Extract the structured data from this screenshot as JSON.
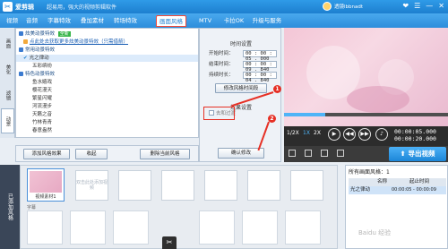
{
  "app": {
    "name": "爱剪辑",
    "slogan": "超易用，强大的视频剪辑软件",
    "account": "透镜lbbnadt",
    "window_buttons": [
      "❤",
      "☰",
      "—",
      "✕"
    ]
  },
  "tabs": [
    {
      "label": "视频"
    },
    {
      "label": "音频"
    },
    {
      "label": "字幕特效"
    },
    {
      "label": "叠加素材"
    },
    {
      "label": "转场特效"
    },
    {
      "label": "画面风格"
    },
    {
      "label": "MTV"
    },
    {
      "label": "卡拉OK"
    },
    {
      "label": "升级与服务"
    }
  ],
  "active_tab": "画面风格",
  "side_nav": [
    {
      "label": "画面"
    },
    {
      "label": "美化"
    },
    {
      "label": "滤镜"
    },
    {
      "label": "动景"
    }
  ],
  "effect_list": [
    {
      "label": "炫美动景特效",
      "type": "category",
      "tag": "全新"
    },
    {
      "label": "点此处去获取更多炫美动景特效（只需借箭）",
      "type": "link"
    },
    {
      "label": "常用动景特效",
      "type": "category"
    },
    {
      "label": "光之律动",
      "type": "item",
      "selected": true
    },
    {
      "label": "五彩缤纷",
      "type": "item"
    },
    {
      "label": "特色动景特效",
      "type": "category"
    },
    {
      "label": "鱼水嬉戏",
      "type": "item"
    },
    {
      "label": "樱花漫天",
      "type": "item"
    },
    {
      "label": "繁星闪耀",
      "type": "item"
    },
    {
      "label": "河流漫步",
      "type": "item"
    },
    {
      "label": "天籁之音",
      "type": "item"
    },
    {
      "label": "竹林青青",
      "type": "item"
    },
    {
      "label": "春意盎然",
      "type": "item"
    }
  ],
  "settings": {
    "time_section": "时间设置",
    "start_label": "开始时间：",
    "start_value": "00 : 00 : 05 . 000",
    "end_label": "结束时间：",
    "end_value": "00 : 00 : 09 . 840",
    "duration_label": "持续时长：",
    "duration_value": "00 : 00 : 04 . 840",
    "modify_time_button": "修改风格时间段",
    "effect_section": "效果设置",
    "checkbox_label": "去和过渡",
    "confirm_button": "确认修改",
    "badge_1": "1",
    "badge_2": "2"
  },
  "actions": {
    "add_button": "添加风格效果",
    "collect_button": "收起",
    "delete_button": "删除当前风格"
  },
  "player": {
    "speeds": [
      "1/2X",
      "1X",
      "2X"
    ],
    "active_speed": "1X",
    "current_time": "00:00:05.000",
    "total_time": "00:00:20.000",
    "export_label": "导出视频",
    "progress": 0.25
  },
  "timeline": {
    "side_label": "已添加风格",
    "first_clip_name": "视频素材1",
    "placeholder": "双击此处添加视频",
    "subtitle_label": "字幕"
  },
  "style_table": {
    "title": "所有画面风格：",
    "count": "1",
    "col_name": "名称",
    "col_time": "起止时间",
    "rows": [
      {
        "name": "光之律动",
        "time": "00:00:05 - 00:00:09"
      }
    ]
  },
  "watermark": "Baidu 经验"
}
